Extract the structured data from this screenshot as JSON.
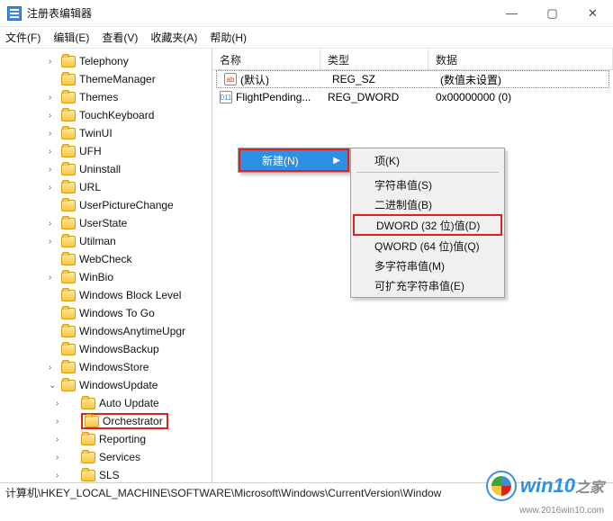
{
  "title": "注册表编辑器",
  "win_controls": {
    "min": "—",
    "max": "▢",
    "close": "✕"
  },
  "menubar": [
    "文件(F)",
    "编辑(E)",
    "查看(V)",
    "收藏夹(A)",
    "帮助(H)"
  ],
  "tree": [
    {
      "label": "Telephony",
      "expand": ">"
    },
    {
      "label": "ThemeManager",
      "expand": ""
    },
    {
      "label": "Themes",
      "expand": ">"
    },
    {
      "label": "TouchKeyboard",
      "expand": ">"
    },
    {
      "label": "TwinUI",
      "expand": ">"
    },
    {
      "label": "UFH",
      "expand": ">"
    },
    {
      "label": "Uninstall",
      "expand": ">"
    },
    {
      "label": "URL",
      "expand": ">"
    },
    {
      "label": "UserPictureChange",
      "expand": ""
    },
    {
      "label": "UserState",
      "expand": ">"
    },
    {
      "label": "Utilman",
      "expand": ">"
    },
    {
      "label": "WebCheck",
      "expand": ""
    },
    {
      "label": "WinBio",
      "expand": ">"
    },
    {
      "label": "Windows Block Level",
      "expand": ""
    },
    {
      "label": "Windows To Go",
      "expand": ""
    },
    {
      "label": "WindowsAnytimeUpgr",
      "expand": ""
    },
    {
      "label": "WindowsBackup",
      "expand": ""
    },
    {
      "label": "WindowsStore",
      "expand": ">"
    },
    {
      "label": "WindowsUpdate",
      "expand": "v",
      "highlight": false
    }
  ],
  "tree_children": [
    {
      "label": "Auto Update",
      "expand": ">"
    },
    {
      "label": "Orchestrator",
      "expand": ">",
      "highlight": true
    },
    {
      "label": "Reporting",
      "expand": ">"
    },
    {
      "label": "Services",
      "expand": ">"
    },
    {
      "label": "SLS",
      "expand": ">"
    }
  ],
  "list_headers": {
    "name": "名称",
    "type": "类型",
    "data": "数据"
  },
  "list_rows": [
    {
      "icon": "ab",
      "name": "(默认)",
      "type": "REG_SZ",
      "data": "(数值未设置)",
      "selected": true
    },
    {
      "icon": "01",
      "name": "FlightPending...",
      "type": "REG_DWORD",
      "data": "0x00000000 (0)",
      "selected": false
    }
  ],
  "ctx1": {
    "label": "新建(N)",
    "arrow": "▶"
  },
  "ctx2": [
    {
      "label": "项(K)"
    },
    {
      "sep": true
    },
    {
      "label": "字符串值(S)"
    },
    {
      "label": "二进制值(B)"
    },
    {
      "label": "DWORD (32 位)值(D)",
      "highlight": true
    },
    {
      "label": "QWORD (64 位)值(Q)"
    },
    {
      "label": "多字符串值(M)"
    },
    {
      "label": "可扩充字符串值(E)"
    }
  ],
  "statusbar": "计算机\\HKEY_LOCAL_MACHINE\\SOFTWARE\\Microsoft\\Windows\\CurrentVersion\\Window",
  "watermark": {
    "text1": "win10",
    "text2": "之家",
    "url": "www.2016win10.com"
  }
}
